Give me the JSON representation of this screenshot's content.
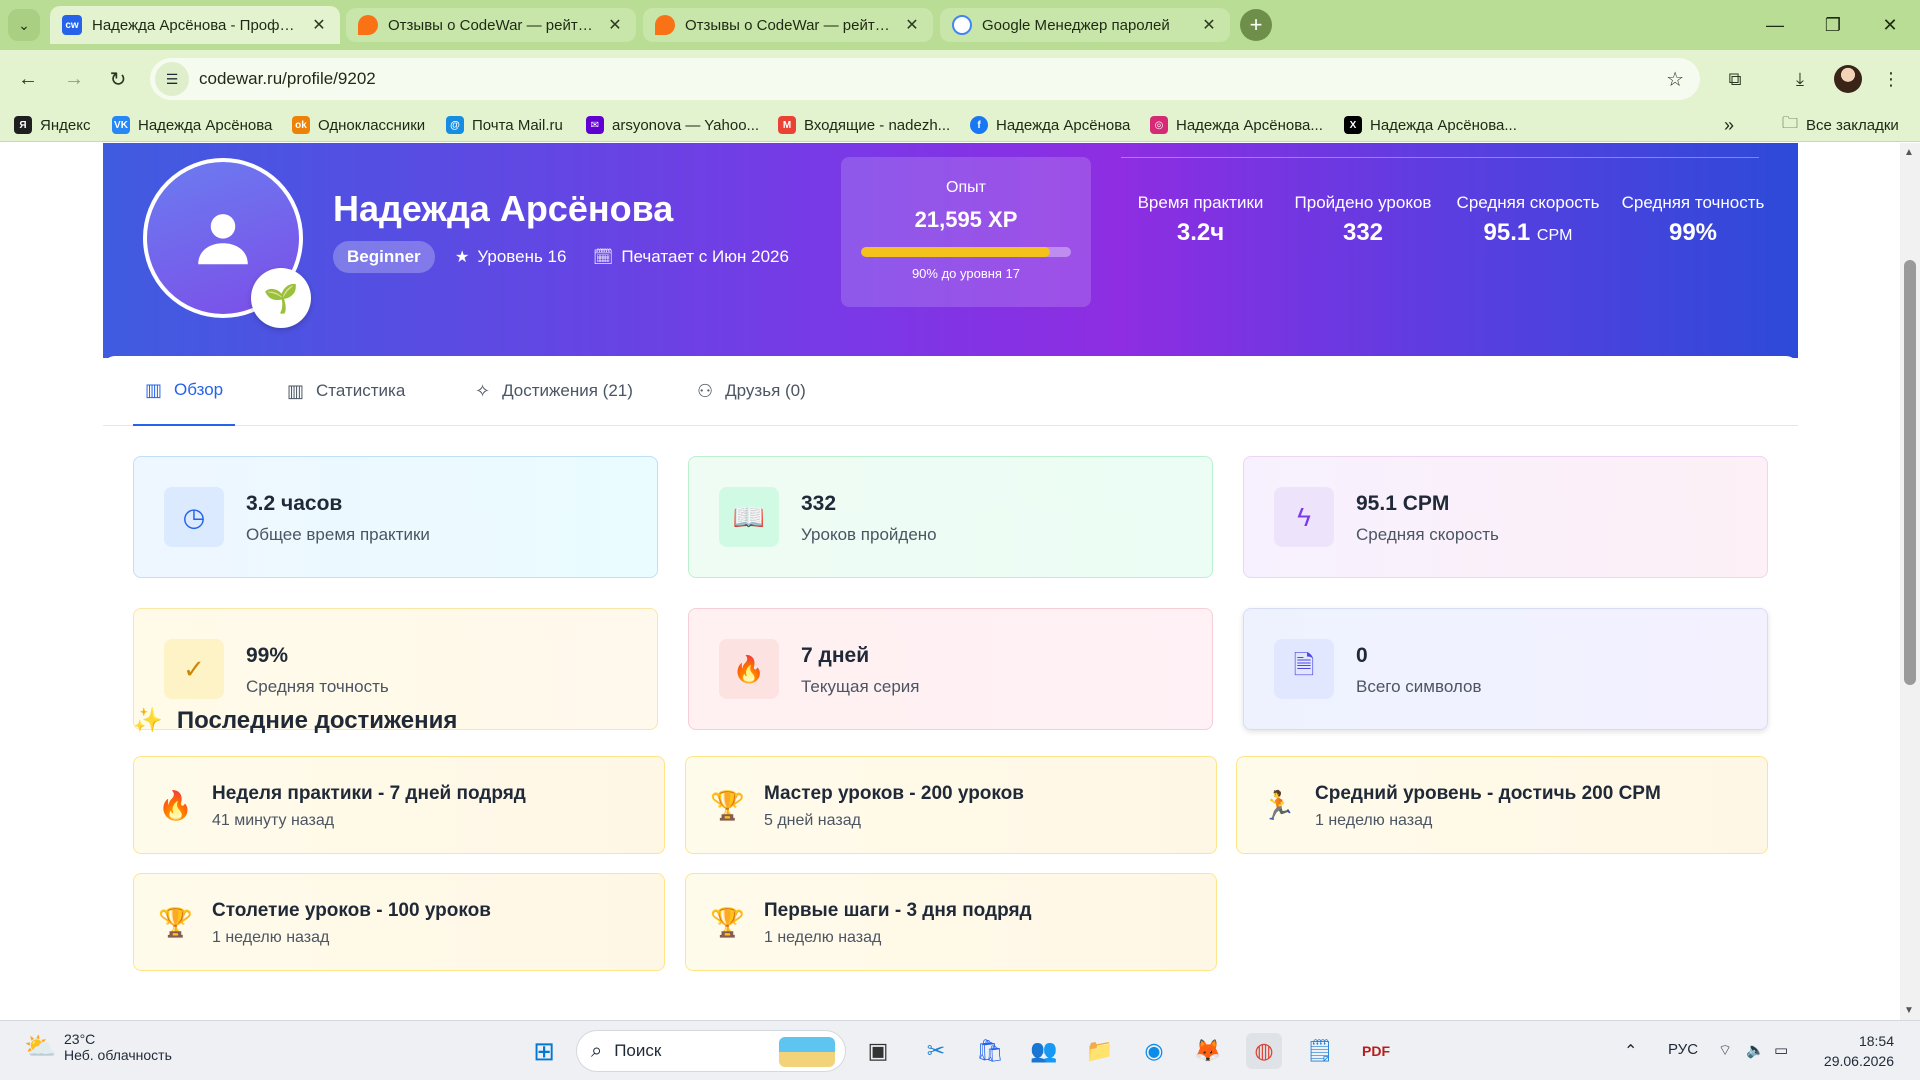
{
  "browser": {
    "tabs": [
      {
        "title": "Надежда Арсёнова - Профиль",
        "favicon": "codewar-favicon",
        "active": true
      },
      {
        "title": "Отзывы о CodeWar — рейтинг",
        "favicon": "review-favicon",
        "active": false
      },
      {
        "title": "Отзывы о CodeWar — рейтинг",
        "favicon": "review-favicon",
        "active": false
      },
      {
        "title": "Google Менеджер паролей",
        "favicon": "google-password-favicon",
        "active": false
      }
    ],
    "url": "codewar.ru/profile/9202",
    "bookmarks": [
      {
        "label": "Яндекс",
        "icon": "yandex-icon",
        "color": "#1f1f1f"
      },
      {
        "label": "Надежда Арсёнова",
        "icon": "vk-icon",
        "color": "#2787f5"
      },
      {
        "label": "Одноклассники",
        "icon": "ok-icon",
        "color": "#ee8208"
      },
      {
        "label": "Почта Mail.ru",
        "icon": "mail-icon",
        "color": "#168de2"
      },
      {
        "label": "arsyonova — Yahoo...",
        "icon": "yahoo-mail-icon",
        "color": "#6001d2"
      },
      {
        "label": "Входящие - nadezh...",
        "icon": "gmail-icon",
        "color": "#ea4335"
      },
      {
        "label": "Надежда Арсёнова",
        "icon": "facebook-icon",
        "color": "#1877f2"
      },
      {
        "label": "Надежда Арсёнова...",
        "icon": "instagram-icon",
        "color": "#d62976"
      },
      {
        "label": "Надежда Арсёнова...",
        "icon": "x-icon",
        "color": "#000000"
      }
    ],
    "all_bookmarks": "Все закладки"
  },
  "profile": {
    "name": "Надежда Арсёнова",
    "rank": "Beginner",
    "level_text": "Уровень 16",
    "since_text": "Печатает с Июн 2026",
    "xp": {
      "label": "Опыт",
      "value": "21,595 XP",
      "progress_percent": 90,
      "next_text": "90% до уровня 17"
    },
    "hero_stats": [
      {
        "label": "Время практики",
        "value": "3.2ч",
        "unit": ""
      },
      {
        "label": "Пройдено уроков",
        "value": "332",
        "unit": ""
      },
      {
        "label": "Средняя скорость",
        "value": "95.1",
        "unit": "CPM"
      },
      {
        "label": "Средняя точность",
        "value": "99%",
        "unit": ""
      }
    ]
  },
  "tabs": [
    {
      "label": "Обзор",
      "icon": "chart-bar-icon",
      "active": true
    },
    {
      "label": "Статистика",
      "icon": "chart-bar-icon",
      "active": false
    },
    {
      "label": "Достижения (21)",
      "icon": "sparkles-icon",
      "active": false
    },
    {
      "label": "Друзья (0)",
      "icon": "users-icon",
      "active": false
    }
  ],
  "stat_cards": [
    {
      "value": "3.2 часов",
      "label": "Общее время практики",
      "icon": "clock-icon"
    },
    {
      "value": "332",
      "label": "Уроков пройдено",
      "icon": "book-icon"
    },
    {
      "value": "95.1 CPM",
      "label": "Средняя скорость",
      "icon": "lightning-icon"
    },
    {
      "value": "99%",
      "label": "Средняя точность",
      "icon": "check-icon"
    },
    {
      "value": "7 дней",
      "label": "Текущая серия",
      "icon": "flame-icon"
    },
    {
      "value": "0",
      "label": "Всего символов",
      "icon": "document-icon"
    }
  ],
  "achievements": {
    "title": "Последние достижения",
    "items": [
      {
        "title": "Неделя практики - 7 дней подряд",
        "time": "41 минуту назад",
        "icon": "fire-icon"
      },
      {
        "title": "Мастер уроков - 200 уроков",
        "time": "5 дней назад",
        "icon": "trophy-icon"
      },
      {
        "title": "Средний уровень - достичь 200 CPM",
        "time": "1 неделю назад",
        "icon": "runner-icon"
      },
      {
        "title": "Столетие уроков - 100 уроков",
        "time": "1 неделю назад",
        "icon": "trophy-icon"
      },
      {
        "title": "Первые шаги - 3 дня подряд",
        "time": "1 неделю назад",
        "icon": "trophy-icon"
      }
    ]
  },
  "taskbar": {
    "weather_temp": "23°C",
    "weather_desc": "Неб. облачность",
    "search_placeholder": "Поиск",
    "language": "РУС",
    "time": "18:54",
    "date": "29.06.2026"
  }
}
